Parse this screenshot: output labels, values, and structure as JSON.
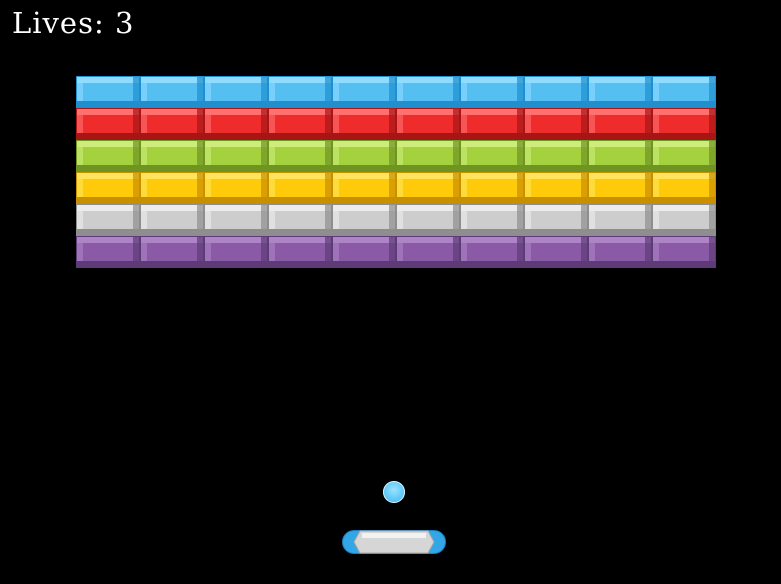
{
  "hud": {
    "lives_label": "Lives:",
    "lives_value": "3"
  },
  "bricks": {
    "columns": 10,
    "rows": [
      {
        "color": "blue",
        "face": "#55bff2",
        "light": "#8fdcff",
        "dark": "#1f8fd0"
      },
      {
        "color": "red",
        "face": "#ee2c2c",
        "light": "#ff7070",
        "dark": "#a81515"
      },
      {
        "color": "green",
        "face": "#a6d13e",
        "light": "#cdec7c",
        "dark": "#6e9422"
      },
      {
        "color": "yellow",
        "face": "#ffca0a",
        "light": "#ffe45c",
        "dark": "#c88f00"
      },
      {
        "color": "silver",
        "face": "#cdcdcd",
        "light": "#ececec",
        "dark": "#8e8e8e"
      },
      {
        "color": "purple",
        "face": "#8a5aa6",
        "light": "#ad84c6",
        "dark": "#5e3a78"
      }
    ]
  },
  "ball": {
    "color": "#5cc6f8"
  },
  "paddle": {
    "cap_color": "#33a6e8",
    "body_color": "#d6d6d6"
  }
}
